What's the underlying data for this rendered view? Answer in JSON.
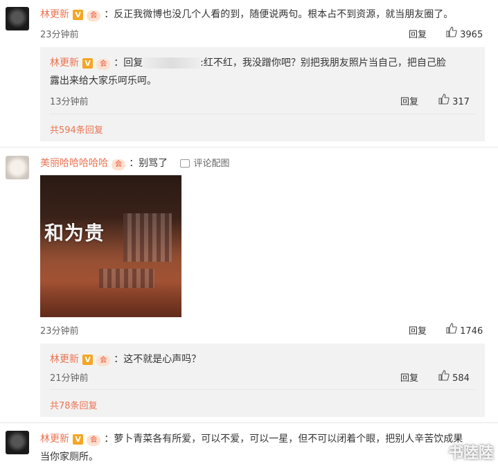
{
  "comments": [
    {
      "user": "林更新",
      "text": "：反正我微博也没几个人看的到，随便说两句。根本占不到资源，就当朋友圈了。",
      "time": "23分钟前",
      "reply_label": "回复",
      "likes": "3965",
      "sub": {
        "user": "林更新",
        "prefix": "：回复",
        "masked_name": "xxxxxxxxxx",
        "text_line1": ":红不红，我没蹭你吧？别把我朋友照片当自己，把自己脸",
        "text_line2": "露出来给大家乐呵乐呵。",
        "time": "13分钟前",
        "reply_label": "回复",
        "likes": "317"
      },
      "more": "共594条回复"
    },
    {
      "user": "美丽哈哈哈哈哈",
      "text": "：别骂了",
      "pic_label": "评论配图",
      "photo_text": "和为贵",
      "time": "23分钟前",
      "reply_label": "回复",
      "likes": "1746",
      "sub": {
        "user": "林更新",
        "text": "：这不就是心声吗？",
        "time": "21分钟前",
        "reply_label": "回复",
        "likes": "584"
      },
      "more": "共78条回复"
    },
    {
      "user": "林更新",
      "text_line1": "：萝卜青菜各有所爱，可以不爱，可以一星，但不可以闭着个眼，把别人辛苦饮成果",
      "text_line2": "当你家厕所。"
    }
  ],
  "badges": {
    "v": "V",
    "club": "会"
  },
  "watermark": "书陸陸",
  "colors": {
    "username": "#eb7350",
    "badge_v": "#f5a623",
    "reply_bg": "#f2f2f2"
  }
}
